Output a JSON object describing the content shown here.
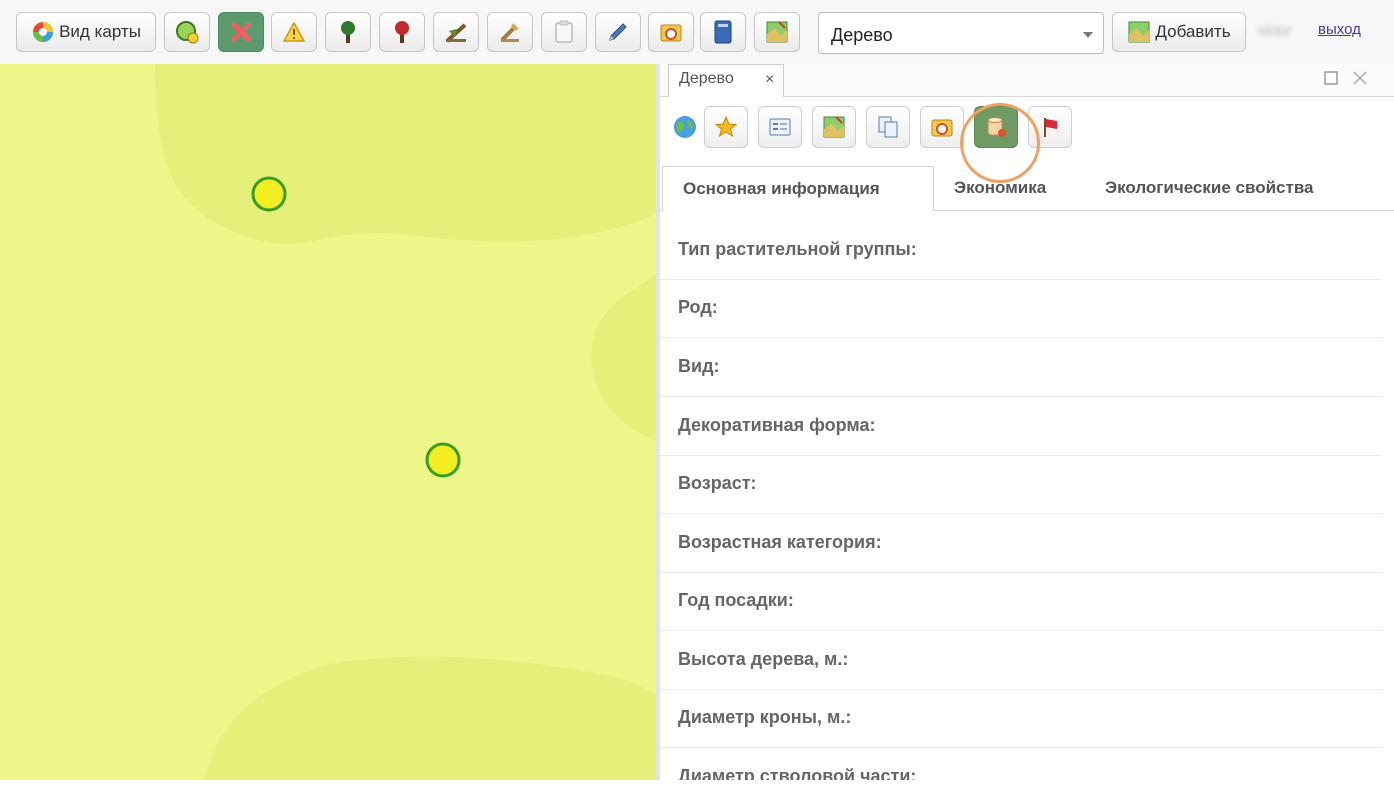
{
  "toolbar": {
    "map_view_label": "Вид карты",
    "dropdown_value": "Дерево",
    "add_label": "Добавить",
    "username": "victor",
    "logout_label": "выход"
  },
  "panel": {
    "window_tab_label": "Дерево",
    "close_tab_glyph": "×",
    "section_tabs": [
      {
        "label": "Основная информация",
        "selected": true
      },
      {
        "label": "Экономика",
        "selected": false
      },
      {
        "label": "Экологические свойства",
        "selected": false
      }
    ],
    "fields": [
      "Тип растительной группы:",
      "Род:",
      "Вид:",
      "Декоративная форма:",
      "Возраст:",
      "Возрастная категория:",
      "Год посадки:",
      "Высота дерева, м.:",
      "Диаметр кроны, м.:",
      "Диаметр стволовой части:"
    ]
  },
  "colors": {
    "map_base": "#eef68a",
    "map_dark_zone": "#e4f07a",
    "tree_marker_fill": "#f2ee22",
    "tree_marker_border": "#3a9d22",
    "active_button": "#5d9b6f",
    "highlight_ring": "#f0a060",
    "logout_link": "#4a3ba0"
  },
  "icons": [
    "map-view-icon",
    "add-point-icon",
    "delete-icon",
    "warning-icon",
    "tree-green-icon",
    "tree-red-icon",
    "felling-icon",
    "pruning-icon",
    "clipboard-icon",
    "pen-icon",
    "photo-icon",
    "book-icon",
    "map-layer-icon",
    "globe-icon",
    "star-icon",
    "form-icon",
    "map-edit-icon",
    "copy-icon",
    "photo-gallery-icon",
    "database-icon",
    "flag-icon"
  ]
}
